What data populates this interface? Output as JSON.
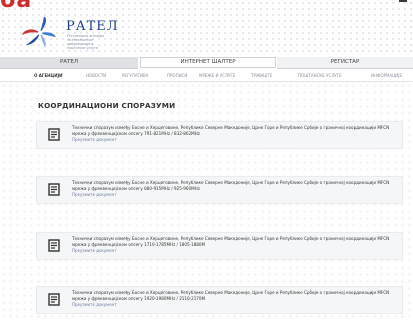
{
  "header": {
    "title_fragment": "ба",
    "logo_name": "РАТЕЛ",
    "logo_subtitle": "Регулаторна агенција\nза електронске\nкомуникације и\nпоштанске услуге"
  },
  "top_tabs": [
    {
      "label": "РАТЕЛ"
    },
    {
      "label": "ИНТЕРНЕТ ШАЛТЕР"
    },
    {
      "label": "РЕГИСТАР"
    }
  ],
  "nav": [
    {
      "label": "О АГЕНЦИЈИ"
    },
    {
      "label": "НОВОСТИ"
    },
    {
      "label": "РЕГУЛАТИВА"
    },
    {
      "label": "ПРОПИСИ"
    },
    {
      "label": "МРЕЖЕ И УСЛУГЕ"
    },
    {
      "label": "ТРЖИШТЕ"
    },
    {
      "label": "ПОШТАНСКЕ УСЛУГЕ"
    },
    {
      "label": "ИНФОРМАЦИЈЕ"
    }
  ],
  "page_title": "КООРДИНАЦИОНИ СПОРАЗУМИ",
  "documents": [
    {
      "text": "Технички споразум између Босне и Херцеговине, Републике Северне Македоније, Црне Горе и Републике Србије о граничној координацији MFCN мрежа у фреквенцијском опсегу 791-821MHz / 832-862MHz",
      "link": "Преузмите документ"
    },
    {
      "text": "Технички споразум између Босне и Херцеговине, Републике Северне Македоније, Црне Горе и Републике Србије о граничној координацији MFCN мрежа у фреквенцијском опсегу 880-915MHz / 925-960MHz",
      "link": "Преузмите документ"
    },
    {
      "text": "Технички споразум између Босне и Херцеговине, Републике Северне Македоније, Црне Горе и Републике Србије о граничној координацији MFCN мрежа у фреквенцијском опсегу 1710-1785MHz / 1805-1880M",
      "link": "Преузмите документ"
    },
    {
      "text": "Технички споразум између Босне и Херцеговине, Републике Северне Македоније, Црне Горе и Републике Србије о граничној координацији MFCN мрежа у фреквенцијском опсегу 1920-1980MHz / 2110-2170M",
      "link": "Преузмите документ"
    }
  ],
  "colors": {
    "brand_blue": "#1a3c8a",
    "accent_red": "#cc2b2b",
    "link": "#6d7fa0"
  }
}
